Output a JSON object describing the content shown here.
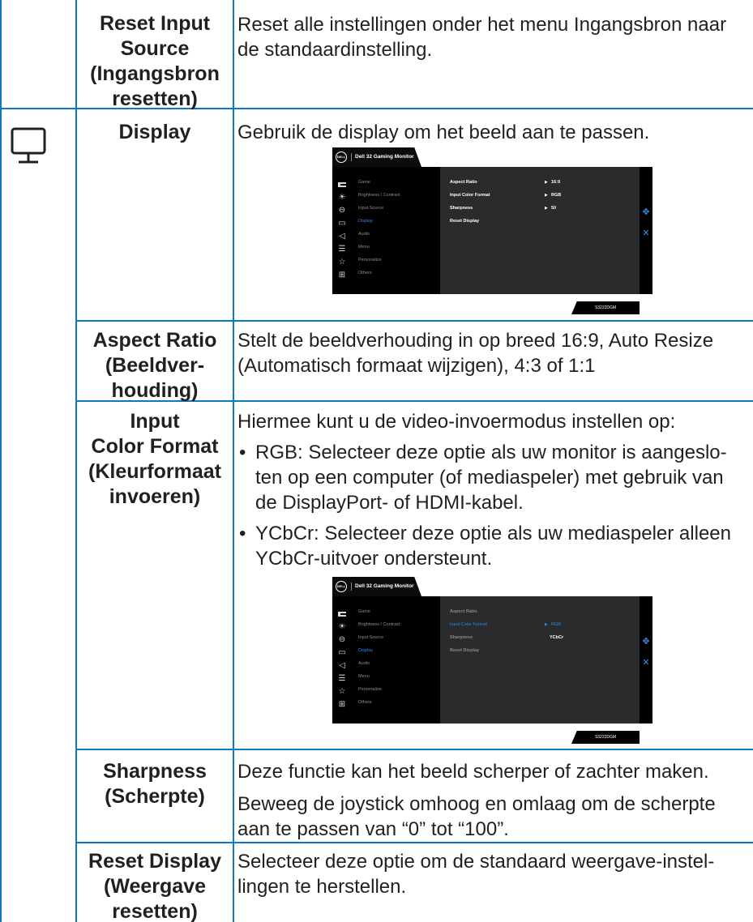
{
  "rows": {
    "reset_input": {
      "name": "Reset Input Source (Ingangsbron resetten)",
      "name_lines": [
        "Reset Input",
        "Source",
        "(Ingangsbron",
        "resetten)"
      ],
      "desc": "Reset alle instellingen onder het menu Ingangsbron naar de standaardinstelling."
    },
    "display": {
      "icon": "monitor-icon",
      "name": "Display",
      "desc": "Gebruik de display om het beeld aan te passen."
    },
    "aspect": {
      "name_lines": [
        "Aspect Ratio",
        "(Beeldver-",
        "houding)"
      ],
      "desc": "Stelt de beeldverhouding in op breed 16:9, Auto Resize (Automatisch formaat wijzigen), 4:3 of 1:1"
    },
    "color_format": {
      "name_lines": [
        "Input",
        "Color Format",
        "(Kleurformaat",
        "invoeren)"
      ],
      "intro": "Hiermee kunt u de video-invoermodus instellen op:",
      "bullets": [
        {
          "label": "RGB:",
          "text": " Selecteer deze optie als uw monitor is aangeslo- ten op een computer (of mediaspeler) met gebruik van de DisplayPort- of HDMI-kabel."
        },
        {
          "label": "YCbCr:",
          "text": " Selecteer deze optie als uw mediaspeler alleen YCbCr-uitvoer ondersteunt."
        }
      ]
    },
    "sharpness": {
      "name_lines": [
        "Sharpness",
        "(Scherpte)"
      ],
      "desc1": "Deze functie kan het beeld scherper of zachter maken.",
      "desc2": "Beweeg de joystick omhoog en omlaag om de scherpte aan te passen van “0” tot “100”."
    },
    "reset_display": {
      "name_lines": [
        "Reset Display",
        "(Weergave",
        "resetten)"
      ],
      "desc": "Selecteer deze optie om de standaard weergave-instel- lingen te herstellen."
    }
  },
  "osd": {
    "logo": "DELL",
    "title": "Dell 32 Gaming Monitor",
    "model": "S3222DGM",
    "menu": [
      {
        "icon": "game-icon",
        "label": "Game"
      },
      {
        "icon": "brightness-icon",
        "label": "Brightness / Contrast"
      },
      {
        "icon": "input-source-icon",
        "label": "Input Source"
      },
      {
        "icon": "display-icon",
        "label": "Display"
      },
      {
        "icon": "audio-icon",
        "label": "Audio"
      },
      {
        "icon": "menu-icon",
        "label": "Menu"
      },
      {
        "icon": "personalize-icon",
        "label": "Personalize"
      },
      {
        "icon": "others-icon",
        "label": "Others"
      }
    ],
    "screen1": {
      "options": [
        {
          "label": "Aspect Ratio",
          "value": "16:9"
        },
        {
          "label": "Input Color Format",
          "value": "RGB"
        },
        {
          "label": "Sharpness",
          "value": "50"
        },
        {
          "label": "Reset Display",
          "value": ""
        }
      ]
    },
    "screen2": {
      "options": [
        {
          "label": "Aspect Ratio",
          "value": ""
        },
        {
          "label": "Input Color Format",
          "value": "RGB"
        },
        {
          "label": "Sharpness",
          "value": "YCbCr"
        },
        {
          "label": "Reset Display",
          "value": ""
        }
      ]
    }
  }
}
